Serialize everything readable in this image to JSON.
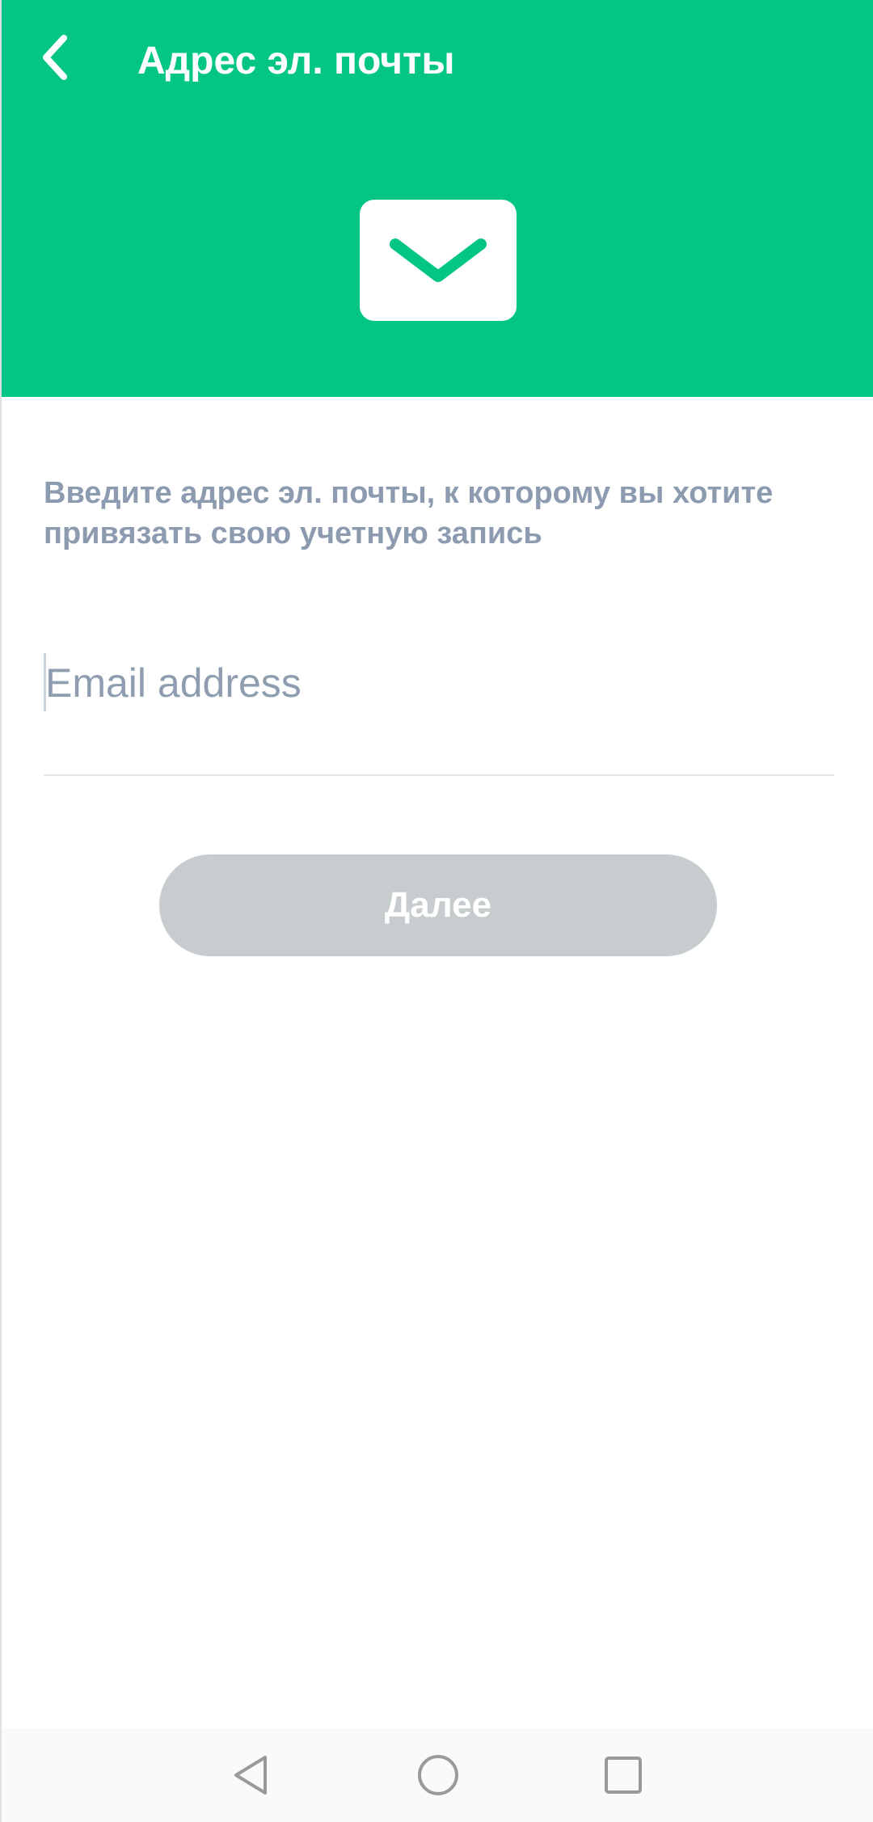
{
  "header": {
    "title": "Адрес эл. почты",
    "back_icon": "chevron-left-icon",
    "hero_icon": "envelope-icon",
    "background_color": "#03c686"
  },
  "main": {
    "instruction": "Введите адрес эл. почты, к которому вы хотите привязать свою учетную запись",
    "email_field": {
      "value": "",
      "placeholder": "Email address"
    },
    "next_button": {
      "label": "Далее",
      "color": "#c7cdcf"
    }
  },
  "system_nav": {
    "back_icon": "triangle-back-icon",
    "home_icon": "circle-home-icon",
    "recents_icon": "square-recents-icon"
  }
}
